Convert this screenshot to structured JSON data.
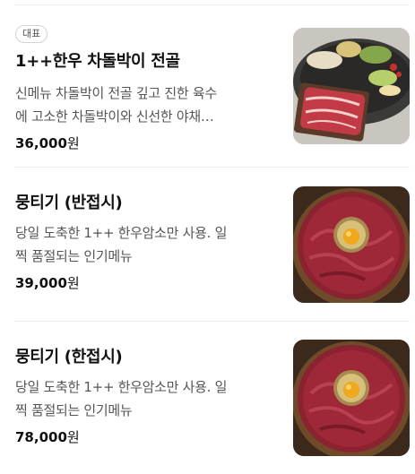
{
  "menu": {
    "items": [
      {
        "badge": "대표",
        "name": "1++한우 차돌박이 전골",
        "description_line1": "신메뉴 차돌박이 전골 깊고 진한 육수",
        "description_line2": "에 고소한 차돌박이와 신선한 야채…",
        "price": "36,000",
        "currency": "원",
        "image_icon": "hotpot-photo"
      },
      {
        "badge": "",
        "name": "뭉티기 (반접시)",
        "description_line1": "당일 도축한 1++ 한우암소만 사용. 일",
        "description_line2": "찍 품절되는 인기메뉴",
        "price": "39,000",
        "currency": "원",
        "image_icon": "raw-beef-plate-photo"
      },
      {
        "badge": "",
        "name": "뭉티기 (한접시)",
        "description_line1": "당일 도축한 1++ 한우암소만 사용. 일",
        "description_line2": "찍 품절되는 인기메뉴",
        "price": "78,000",
        "currency": "원",
        "image_icon": "raw-beef-plate-photo"
      }
    ]
  },
  "colors": {
    "text_primary": "#111111",
    "text_secondary": "#555555",
    "divider": "#eeeeee",
    "badge_border": "#d3d3d3"
  }
}
